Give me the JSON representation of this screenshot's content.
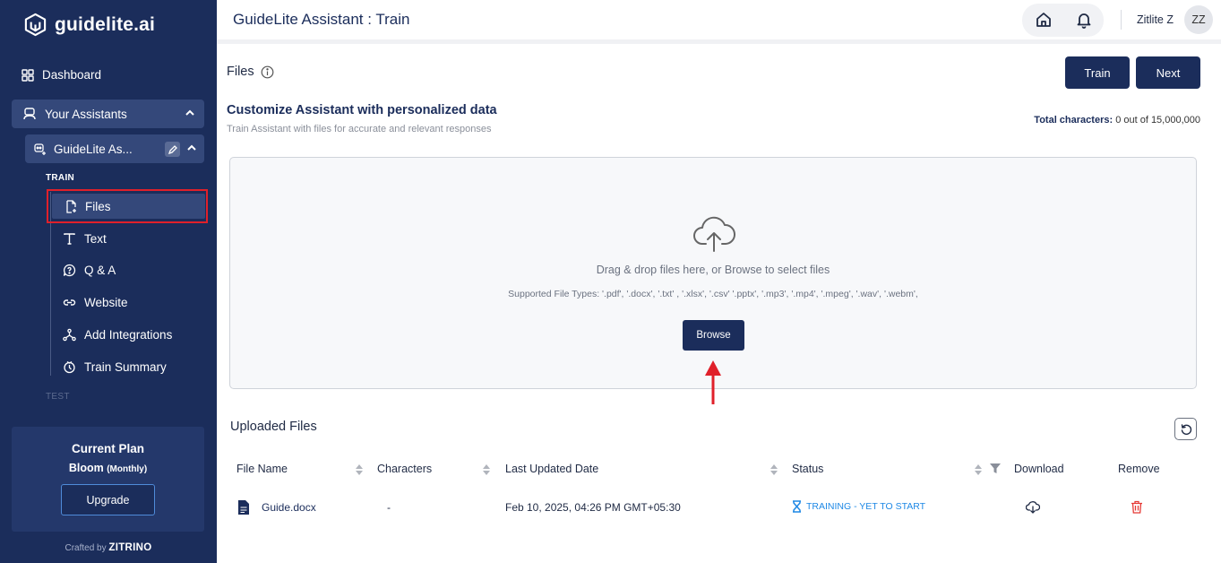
{
  "sidebar": {
    "logo_text": "guidelite.ai",
    "dashboard_label": "Dashboard",
    "assistants_label": "Your Assistants",
    "assistant_name": "GuideLite As...",
    "train_section_label": "TRAIN",
    "test_section_label": "TEST",
    "train_items": [
      {
        "label": "Files",
        "icon": "file-add-icon",
        "active": true
      },
      {
        "label": "Text",
        "icon": "text-icon"
      },
      {
        "label": "Q & A",
        "icon": "chat-question-icon"
      },
      {
        "label": "Website",
        "icon": "link-icon"
      },
      {
        "label": "Add Integrations",
        "icon": "integrations-icon"
      },
      {
        "label": "Train Summary",
        "icon": "train-summary-icon"
      }
    ],
    "plan": {
      "title": "Current Plan",
      "name": "Bloom",
      "period": "(Monthly)",
      "upgrade_label": "Upgrade"
    },
    "crafted_prefix": "Crafted by",
    "crafted_brand": "ZITRINO"
  },
  "header": {
    "title": "GuideLite Assistant : Train",
    "user_name": "Zitlite Z",
    "avatar_initials": "ZZ"
  },
  "main": {
    "files_title": "Files",
    "train_button": "Train",
    "next_button": "Next",
    "customize_title": "Customize Assistant with personalized data",
    "customize_subtitle": "Train Assistant with files for accurate and relevant responses",
    "total_chars_label": "Total characters:",
    "total_chars_value": "0 out of 15,000,000",
    "dropzone": {
      "drag_text": "Drag & drop files here, or Browse to select files",
      "supported_text": "Supported File Types: '.pdf', '.docx', '.txt' , '.xlsx', '.csv' '.pptx', '.mp3', '.mp4', '.mpeg', '.wav', '.webm',",
      "browse_label": "Browse"
    },
    "uploaded_title": "Uploaded Files",
    "table": {
      "headers": [
        "File Name",
        "Characters",
        "Last Updated Date",
        "Status",
        "Download",
        "Remove"
      ],
      "rows": [
        {
          "file_name": "Guide.docx",
          "characters": "-",
          "last_updated": "Feb 10, 2025, 04:26 PM GMT+05:30",
          "status": "TRAINING - YET TO START"
        }
      ]
    }
  },
  "colors": {
    "sidebar_bg": "#1b2d5b",
    "accent_dark": "#1b2d5b",
    "status_blue": "#1e88e5",
    "remove_red": "#e53935",
    "highlight_red": "#e0202a"
  }
}
